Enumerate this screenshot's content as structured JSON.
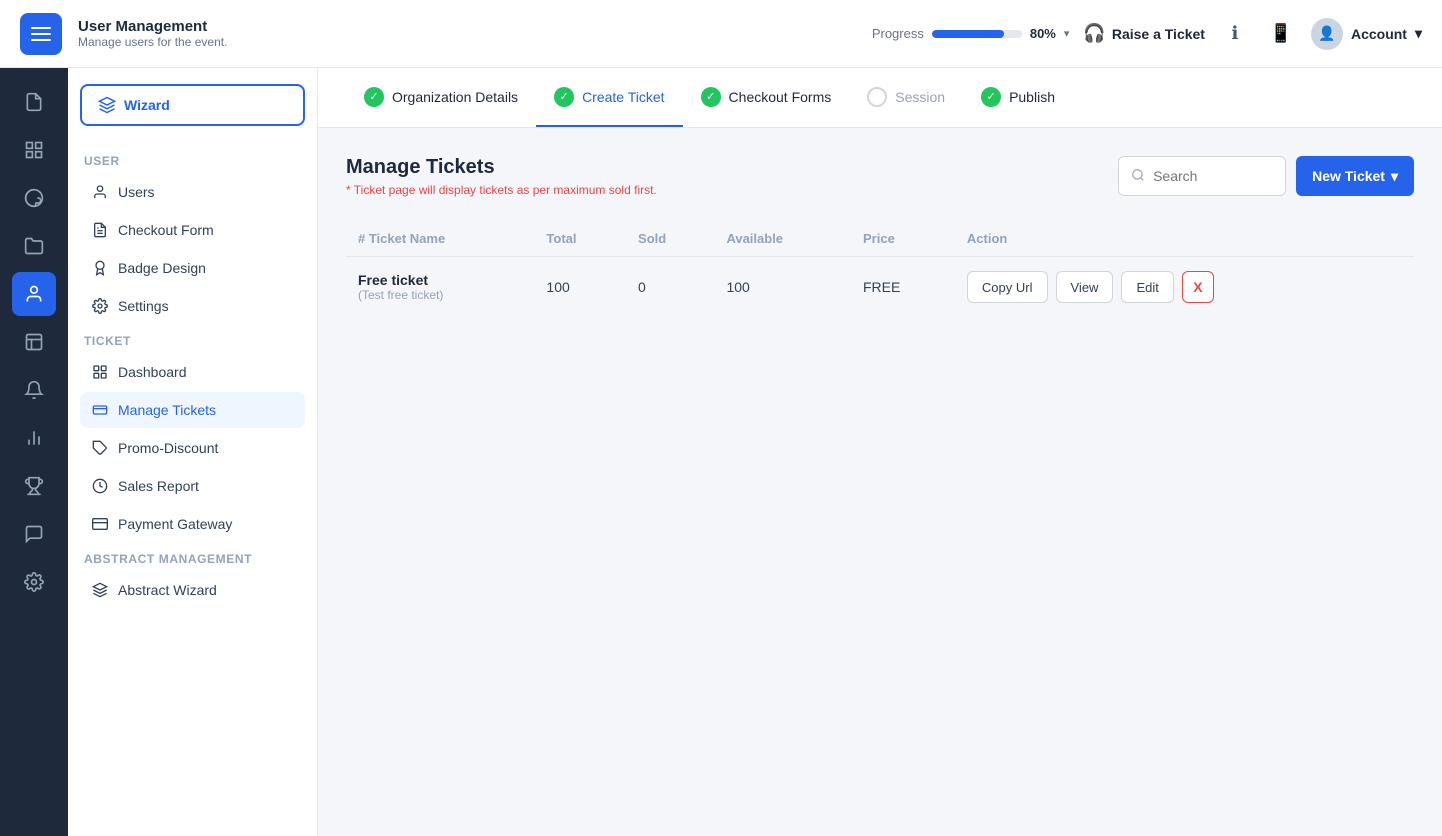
{
  "topnav": {
    "logo_alt": "App Logo",
    "title": "User Management",
    "subtitle": "Manage users for the event.",
    "progress_label": "Progress",
    "progress_pct": "80%",
    "progress_value": 80,
    "raise_ticket_label": "Raise a Ticket",
    "account_label": "Account"
  },
  "wizard_steps": [
    {
      "id": "org-details",
      "label": "Organization Details",
      "state": "done"
    },
    {
      "id": "create-ticket",
      "label": "Create Ticket",
      "state": "active"
    },
    {
      "id": "checkout-forms",
      "label": "Checkout Forms",
      "state": "done"
    },
    {
      "id": "session",
      "label": "Session",
      "state": "none"
    },
    {
      "id": "publish",
      "label": "Publish",
      "state": "done"
    }
  ],
  "sidebar": {
    "wizard_label": "Wizard",
    "sections": [
      {
        "label": "User",
        "items": [
          {
            "id": "users",
            "label": "Users",
            "icon": "person"
          },
          {
            "id": "checkout-form",
            "label": "Checkout Form",
            "icon": "form"
          },
          {
            "id": "badge-design",
            "label": "Badge Design",
            "icon": "badge"
          },
          {
            "id": "settings",
            "label": "Settings",
            "icon": "gear"
          }
        ]
      },
      {
        "label": "Ticket",
        "items": [
          {
            "id": "dashboard",
            "label": "Dashboard",
            "icon": "dashboard"
          },
          {
            "id": "manage-tickets",
            "label": "Manage Tickets",
            "icon": "ticket",
            "active": true
          },
          {
            "id": "promo-discount",
            "label": "Promo-Discount",
            "icon": "tag"
          },
          {
            "id": "sales-report",
            "label": "Sales Report",
            "icon": "chart"
          },
          {
            "id": "payment-gateway",
            "label": "Payment Gateway",
            "icon": "card"
          }
        ]
      },
      {
        "label": "Abstract Management",
        "items": [
          {
            "id": "abstract-wizard",
            "label": "Abstract Wizard",
            "icon": "layers"
          }
        ]
      }
    ]
  },
  "tickets": {
    "title": "Manage Tickets",
    "subtitle": "* Ticket page will display tickets as per maximum sold first.",
    "search_placeholder": "Search",
    "new_ticket_label": "New Ticket",
    "table": {
      "columns": [
        "# Ticket Name",
        "Total",
        "Sold",
        "Available",
        "Price",
        "Action"
      ],
      "rows": [
        {
          "name": "Free ticket",
          "sub": "(Test free ticket)",
          "total": "100",
          "sold": "0",
          "available": "100",
          "price": "FREE",
          "actions": {
            "copy_url": "Copy Url",
            "view": "View",
            "edit": "Edit",
            "delete": "X"
          }
        }
      ]
    }
  },
  "rail_icons": [
    {
      "id": "doc",
      "label": "document-icon",
      "glyph": "📄",
      "active": false
    },
    {
      "id": "grid",
      "label": "grid-icon",
      "glyph": "⊞",
      "active": false
    },
    {
      "id": "palette",
      "label": "palette-icon",
      "glyph": "🎨",
      "active": false
    },
    {
      "id": "folder",
      "label": "folder-icon",
      "glyph": "📁",
      "active": false
    },
    {
      "id": "user",
      "label": "user-icon",
      "glyph": "👤",
      "active": true
    },
    {
      "id": "list",
      "label": "list-icon",
      "glyph": "▤",
      "active": false
    },
    {
      "id": "bell",
      "label": "bell-icon",
      "glyph": "🔔",
      "active": false
    },
    {
      "id": "chart",
      "label": "chart-icon",
      "glyph": "📊",
      "active": false
    },
    {
      "id": "trophy",
      "label": "trophy-icon",
      "glyph": "🏆",
      "active": false
    },
    {
      "id": "chat",
      "label": "chat-icon",
      "glyph": "💬",
      "active": false
    },
    {
      "id": "cog",
      "label": "cog-icon",
      "glyph": "⚙",
      "active": false
    }
  ]
}
